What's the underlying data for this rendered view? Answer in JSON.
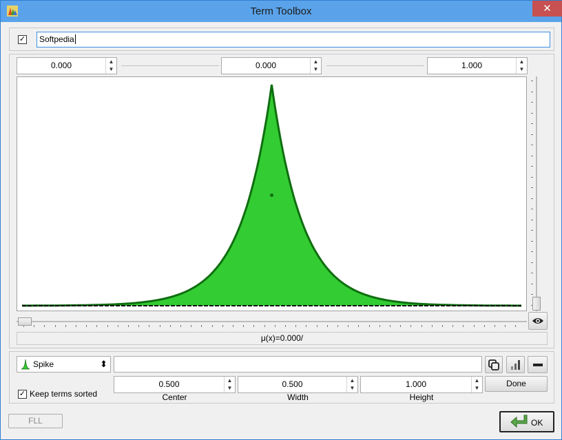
{
  "window": {
    "title": "Term Toolbox",
    "close_glyph": "✕"
  },
  "term": {
    "enabled": true,
    "check_glyph": "✓",
    "name": "Softpedia"
  },
  "range": {
    "min": "0.000",
    "mid": "0.000",
    "max": "1.000"
  },
  "plot": {
    "type": "spike",
    "center": 0.5,
    "width": 0.5,
    "height": 1.0,
    "fill_color": "#33cc33",
    "stroke_color": "#0f6e0f"
  },
  "membership_label": "μ(x)=0.000/",
  "term_type": {
    "selected": "Spike",
    "icon": "spike-icon"
  },
  "params": [
    {
      "value": "0.500",
      "label": "Center"
    },
    {
      "value": "0.500",
      "label": "Width"
    },
    {
      "value": "1.000",
      "label": "Height"
    }
  ],
  "done_label": "Done",
  "keep_sorted": {
    "checked": true,
    "label": "Keep terms sorted"
  },
  "fll_label": "FLL",
  "ok_label": "OK",
  "spin_up": "▲",
  "spin_down": "▼",
  "combo_arrow": "⬍"
}
